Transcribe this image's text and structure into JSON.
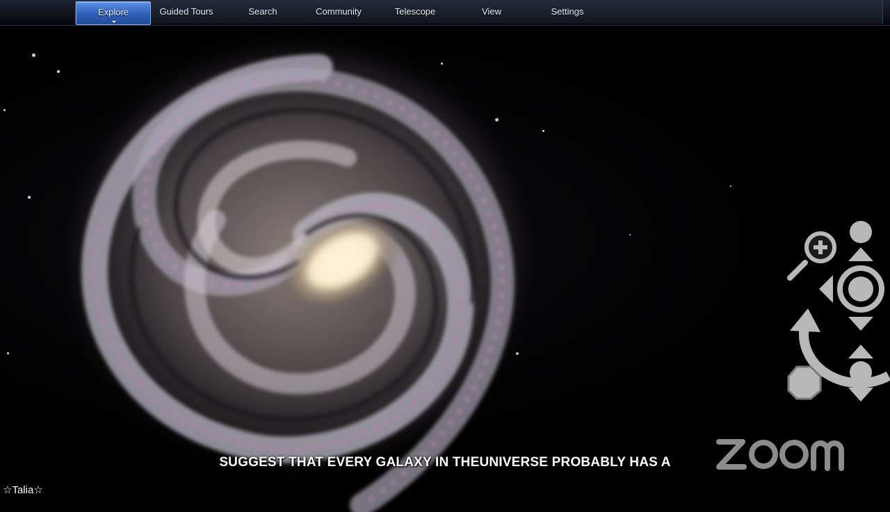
{
  "menu": {
    "tabs": [
      {
        "label": "Explore",
        "active": true
      },
      {
        "label": "Guided Tours"
      },
      {
        "label": "Search"
      },
      {
        "label": "Community"
      },
      {
        "label": "Telescope"
      },
      {
        "label": "View"
      },
      {
        "label": "Settings"
      }
    ]
  },
  "view": {
    "subject_icon": "spiral-galaxy-image",
    "controls": [
      "zoom-in-icon",
      "pan-up-icon",
      "pan-left-icon",
      "pan-center-icon",
      "pan-down-icon",
      "rotate-icon",
      "tilt-up-icon",
      "tilt-down-icon",
      "stop-icon"
    ]
  },
  "overlay": {
    "logo": "zoom",
    "caption": "SUGGEST THAT EVERY GALAXY IN THEUNIVERSE PROBABLY HAS A",
    "participant_name": "☆Talia☆"
  },
  "colors": {
    "active_tab": "#2e5fb8",
    "control_gray": "#b8b8b8",
    "galaxy_core": "#f5e6c8",
    "galaxy_arm_pink": "#d07ab0"
  }
}
